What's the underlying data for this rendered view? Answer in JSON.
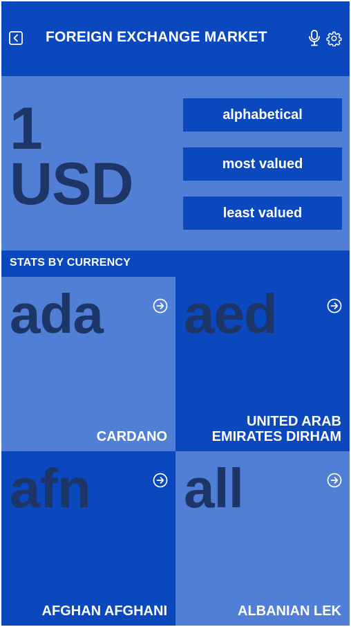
{
  "header": {
    "title": "FOREIGN EXCHANGE MARKET",
    "icons": {
      "back": "back-icon",
      "mic": "mic-icon",
      "settings": "gear-icon"
    }
  },
  "hero": {
    "amount": "1",
    "currency": "USD",
    "sort_buttons": [
      "alphabetical",
      "most valued",
      "least valued"
    ]
  },
  "section": {
    "title": "STATS BY CURRENCY"
  },
  "tiles": [
    {
      "code": "ada",
      "name": "CARDANO"
    },
    {
      "code": "aed",
      "name": "UNITED ARAB EMIRATES DIRHAM"
    },
    {
      "code": "afn",
      "name": "AFGHAN AFGHANI"
    },
    {
      "code": "all",
      "name": "ALBANIAN LEK"
    }
  ],
  "colors": {
    "primary": "#0b47bd",
    "light": "#517fd6",
    "code_text": "#1d3567",
    "text": "#ffffff"
  }
}
